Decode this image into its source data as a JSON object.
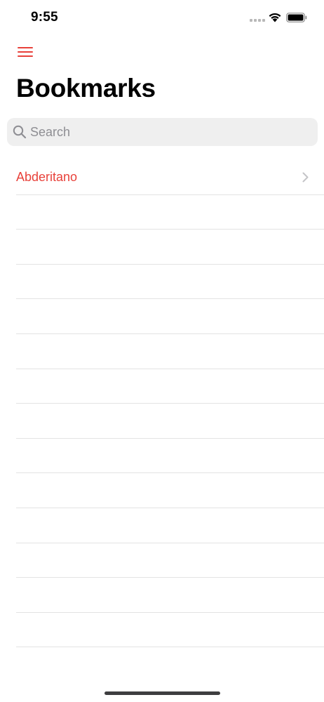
{
  "status_bar": {
    "time": "9:55",
    "icons": [
      "signal-icon",
      "wifi-icon",
      "battery-icon"
    ]
  },
  "header": {
    "menu_icon": "hamburger-menu-icon",
    "title": "Bookmarks"
  },
  "search": {
    "placeholder": "Search",
    "value": "",
    "icon": "search-icon"
  },
  "bookmarks": [
    {
      "label": "Abderitano",
      "icon": "chevron-right-icon"
    }
  ],
  "colors": {
    "accent": "#e8413a",
    "search_background": "#efefef",
    "separator": "#e3e3e3",
    "placeholder": "#8e8e93"
  }
}
